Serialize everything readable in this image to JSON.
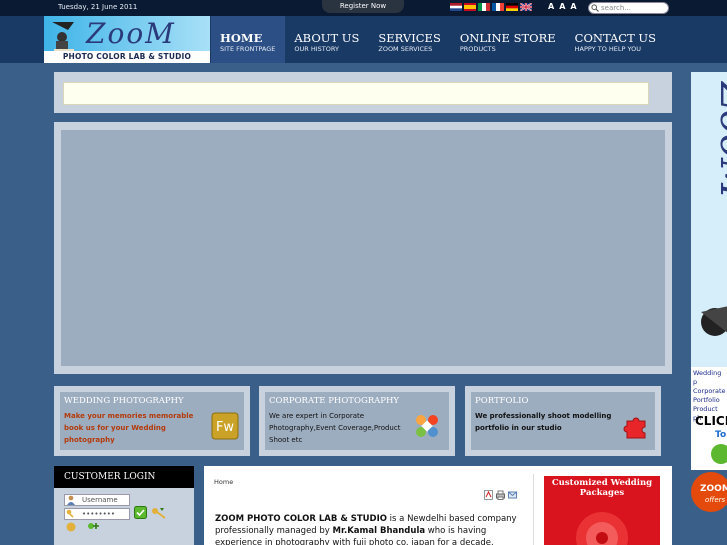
{
  "topbar": {
    "date": "Tuesday, 21 June 2011",
    "register_label": "Register Now",
    "flags": [
      "netherlands-flag",
      "spain-flag",
      "italy-flag",
      "france-flag",
      "germany-flag",
      "uk-flag"
    ],
    "font_size_controls": [
      "A",
      "A",
      "A"
    ],
    "search_placeholder": "search..."
  },
  "logo": {
    "wordmark": "ZooM",
    "tagline": "PHOTO COLOR LAB & STUDIO"
  },
  "nav": [
    {
      "title": "HOME",
      "sub": "SITE FRONTPAGE",
      "active": true
    },
    {
      "title": "ABOUT US",
      "sub": "OUR HISTORY",
      "active": false
    },
    {
      "title": "SERVICES",
      "sub": "ZOOM SERVICES",
      "active": false
    },
    {
      "title": "ONLINE STORE",
      "sub": "PRODUCTS",
      "active": false
    },
    {
      "title": "CONTACT US",
      "sub": "HAPPY TO HELP YOU",
      "active": false
    }
  ],
  "features": [
    {
      "title": "WEDDING PHOTOGRAPHY",
      "text": "Make your memories memorable book us for your Wedding photography",
      "text_color": "#b33a0a",
      "icon": "fireworks-icon"
    },
    {
      "title": "CORPORATE PHOTOGRAPHY",
      "text": "We are expert in Corporate Photography,Event Coverage,Product Shoot etc",
      "text_color": "#111111",
      "icon": "joomla-icon"
    },
    {
      "title": "PORTFOLIO",
      "text": "We professionally shoot modelling portfolio in our studio",
      "text_color": "#111111",
      "icon": "puzzle-icon"
    }
  ],
  "login": {
    "title": "CUSTOMER LOGIN",
    "username_placeholder": "Username",
    "password_value": "••••••••"
  },
  "article": {
    "breadcrumb": "Home",
    "body_brand": "ZOOM PHOTO COLOR LAB & STUDIO",
    "body_part1": " is a Newdelhi based company professionally managed by ",
    "body_owner": "Mr.Kamal Bhandula",
    "body_part2": " who is having experience in photography with fuji photo co. japan for a decade.",
    "tools": [
      "pdf-icon",
      "print-icon",
      "email-icon"
    ]
  },
  "promo": {
    "title": "Customized Wedding Packages"
  },
  "side_banner": {
    "wordmark": "ZooM",
    "list": [
      "Wedding p",
      "Corporate",
      "Portfolio",
      "Product ph"
    ],
    "cta1": "CLICK",
    "cta2": "To",
    "badge_line1": "ZOOM",
    "badge_line2": "offers"
  },
  "colors": {
    "background": "#3a5f88",
    "header": "#1a3a66",
    "nav_active": "#2c4f86",
    "panel": "#c8d2de",
    "panel_inner": "#9dadc0",
    "promo_red": "#d9141f"
  }
}
